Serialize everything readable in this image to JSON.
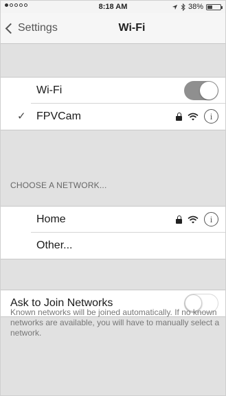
{
  "status_bar": {
    "time": "8:18 AM",
    "battery_text": "38%",
    "battery_level": 0.38,
    "signal_dots_filled": 1,
    "signal_dots_total": 5
  },
  "nav": {
    "back_label": "Settings",
    "title": "Wi-Fi"
  },
  "wifi": {
    "label": "Wi-Fi",
    "enabled": true,
    "connected_network": {
      "name": "FPVCam",
      "secured": true,
      "icon": "wifi-icon"
    }
  },
  "choose_network": {
    "header": "CHOOSE A NETWORK...",
    "networks": [
      {
        "name": "Home",
        "secured": true,
        "icon": "wifi-icon"
      }
    ],
    "other_label": "Other..."
  },
  "ask_to_join": {
    "label": "Ask to Join Networks",
    "enabled": false,
    "description": "Known networks will be joined automatically. If no known networks are available, you will have to manually select a network."
  },
  "colors": {
    "background": "#e1e1e1",
    "toggle_on": "#8f8f8f",
    "cell_background": "#ffffff"
  }
}
